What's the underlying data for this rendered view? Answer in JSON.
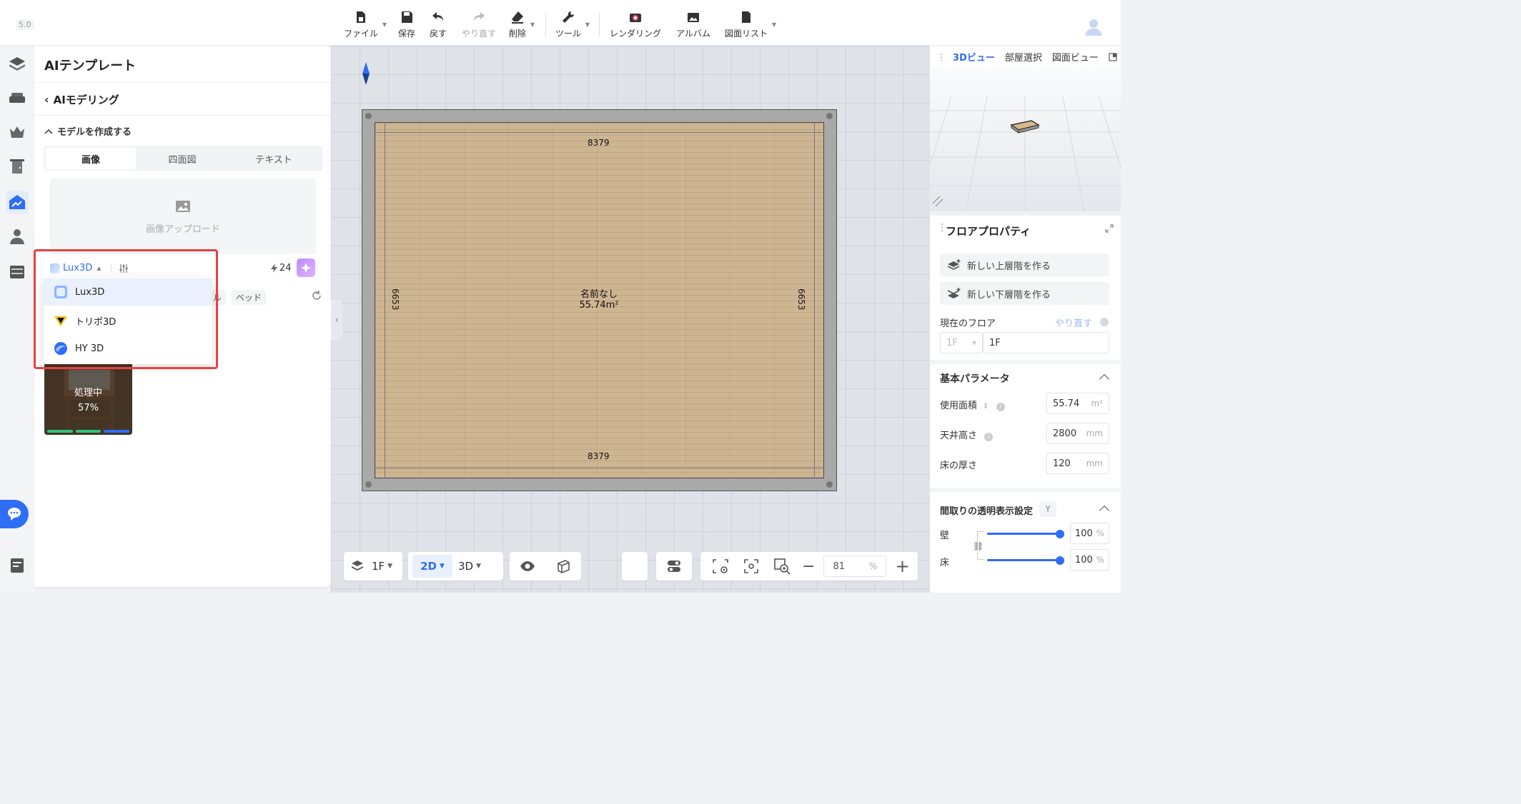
{
  "app": {
    "version": "5.0"
  },
  "toolbar": {
    "file": "ファイル",
    "save": "保存",
    "undo": "戻す",
    "redo": "やり直す",
    "delete": "削除",
    "tools": "ツール",
    "rendering": "レンダリング",
    "album": "アルバム",
    "drawing_list": "図面リスト"
  },
  "left_panel": {
    "title": "AIテンプレート",
    "back_label": "AIモデリング",
    "section_label": "モデルを作成する",
    "tabs": [
      "画像",
      "四面図",
      "テキスト"
    ],
    "upload_label": "画像アップロード",
    "model_selector": {
      "selected": "Lux3D"
    },
    "credits": "24",
    "tags": [
      "ル",
      "ベッド"
    ],
    "dropdown_options": [
      "Lux3D",
      "トリポ3D",
      "HY 3D"
    ],
    "task": {
      "status": "処理中",
      "progress": "57%"
    }
  },
  "canvas": {
    "dim_top": "8379",
    "dim_bottom": "8379",
    "dim_left": "6653",
    "dim_right": "6653",
    "room_name": "名前なし",
    "room_area": "55.74m²"
  },
  "bottom_bar": {
    "floor": "1F",
    "view_2d": "2D",
    "view_3d": "3D",
    "zoom_value": "81",
    "zoom_unit": "%"
  },
  "right_top": {
    "tabs": [
      "3Dビュー",
      "部屋選択",
      "図面ビュー"
    ]
  },
  "floor_props": {
    "title": "フロアプロパティ",
    "add_upper": "新しい上層階を作る",
    "add_lower": "新しい下層階を作る",
    "current_floor_label": "現在のフロア",
    "redo_link": "やり直す",
    "floor_select": "1F",
    "floor_name": "1F",
    "basic_params": "基本パラメータ",
    "area_label": "使用面積",
    "area_value": "55.74",
    "area_unit": "m²",
    "ceiling_label": "天井高さ",
    "ceiling_value": "2800",
    "ceiling_unit": "mm",
    "thickness_label": "床の厚さ",
    "thickness_value": "120",
    "thickness_unit": "mm",
    "transparency_label": "間取りの透明表示設定",
    "transparency_key": "Y",
    "wall_label": "壁",
    "wall_value": "100",
    "wall_level": 1.0,
    "floor_label": "床",
    "floor_value": "100",
    "floor_level": 1.0,
    "percent": "%"
  },
  "colors": {
    "accent": "#2e6df6",
    "highlight_box": "#e8423f"
  }
}
